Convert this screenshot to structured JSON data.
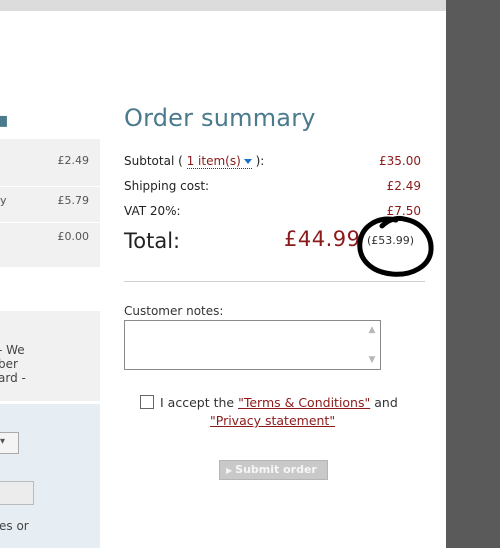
{
  "left_panel": {
    "rows": [
      {
        "label": "",
        "value": "£2.49"
      },
      {
        "label": "y",
        "value": "£5.79"
      },
      {
        "label": "",
        "value": "£0.00"
      }
    ],
    "heading_fragment": "l",
    "note_lines": [
      "- We",
      "ber",
      "ard -"
    ],
    "form_tail": "es or"
  },
  "summary": {
    "title": "Order summary",
    "subtotal_label": "Subtotal (",
    "items_link": "1 item(s)",
    "subtotal_suffix": "):",
    "subtotal_value": "£35.00",
    "shipping_label": "Shipping cost:",
    "shipping_value": "£2.49",
    "vat_label": "VAT 20%:",
    "vat_value": "£7.50",
    "total_label": "Total:",
    "total_value": "£44.99",
    "total_old": "(£53.99)",
    "notes_label": "Customer notes:",
    "notes_value": "",
    "terms_prefix": "I accept the",
    "terms_link": "\"Terms & Conditions\"",
    "terms_and": "and",
    "privacy_link": "\"Privacy statement\"",
    "submit_label": "Submit order"
  },
  "colors": {
    "accent_heading": "#4a7a8c",
    "price": "#8b1a1a",
    "right_panel": "#5a5a5a"
  },
  "icons": [
    "caret-down-icon",
    "checkbox",
    "scroll-up-icon",
    "scroll-down-icon",
    "arrow-right-icon",
    "hand-drawn-circle"
  ]
}
